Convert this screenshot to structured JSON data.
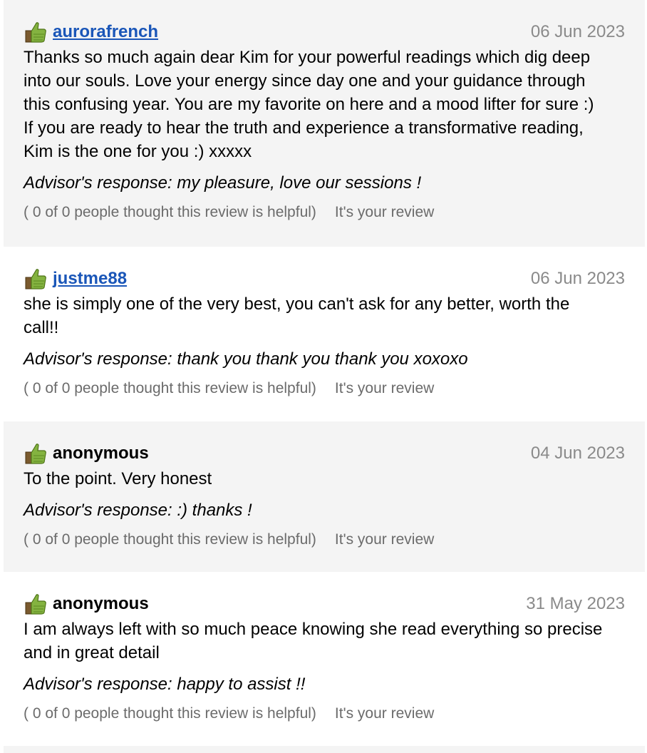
{
  "reviews": [
    {
      "author": "aurorafrench",
      "author_is_link": true,
      "date": "06 Jun 2023",
      "text": "Thanks so much again dear Kim for your powerful readings which dig deep\ninto our souls. Love your energy since day one and your guidance through\nthis confusing year. You are my favorite on here and a mood lifter for sure :)\nIf you are ready to hear the truth and experience a transformative reading,\nKim is the one for you :) xxxxx",
      "response": "Advisor's response: my pleasure, love our sessions !",
      "helpful": "( 0 of 0 people thought this review is helpful)",
      "own": "It's your review"
    },
    {
      "author": "justme88",
      "author_is_link": true,
      "date": "06 Jun 2023",
      "text": "she is simply one of the very best, you can't ask for any better, worth the\ncall!!",
      "response": "Advisor's response: thank you thank you thank you xoxoxo",
      "helpful": "( 0 of 0 people thought this review is helpful)",
      "own": "It's your review"
    },
    {
      "author": "anonymous",
      "author_is_link": false,
      "date": "04 Jun 2023",
      "text": "To the point. Very honest",
      "response": "Advisor's response: :) thanks !",
      "helpful": "( 0 of 0 people thought this review is helpful)",
      "own": "It's your review"
    },
    {
      "author": "anonymous",
      "author_is_link": false,
      "date": "31 May 2023",
      "text": "I am always left with so much peace knowing she read everything so precise\nand in great detail",
      "response": "Advisor's response: happy to assist !!",
      "helpful": "( 0 of 0 people thought this review is helpful)",
      "own": "It's your review"
    }
  ],
  "icons": {
    "thumb": "thumbs-up-icon"
  },
  "colors": {
    "link": "#1a56b8",
    "date": "#8a8a8a",
    "meta": "#6b6b6b",
    "shaded_bg": "#f4f4f4",
    "thumb_green": "#7aa63a"
  }
}
